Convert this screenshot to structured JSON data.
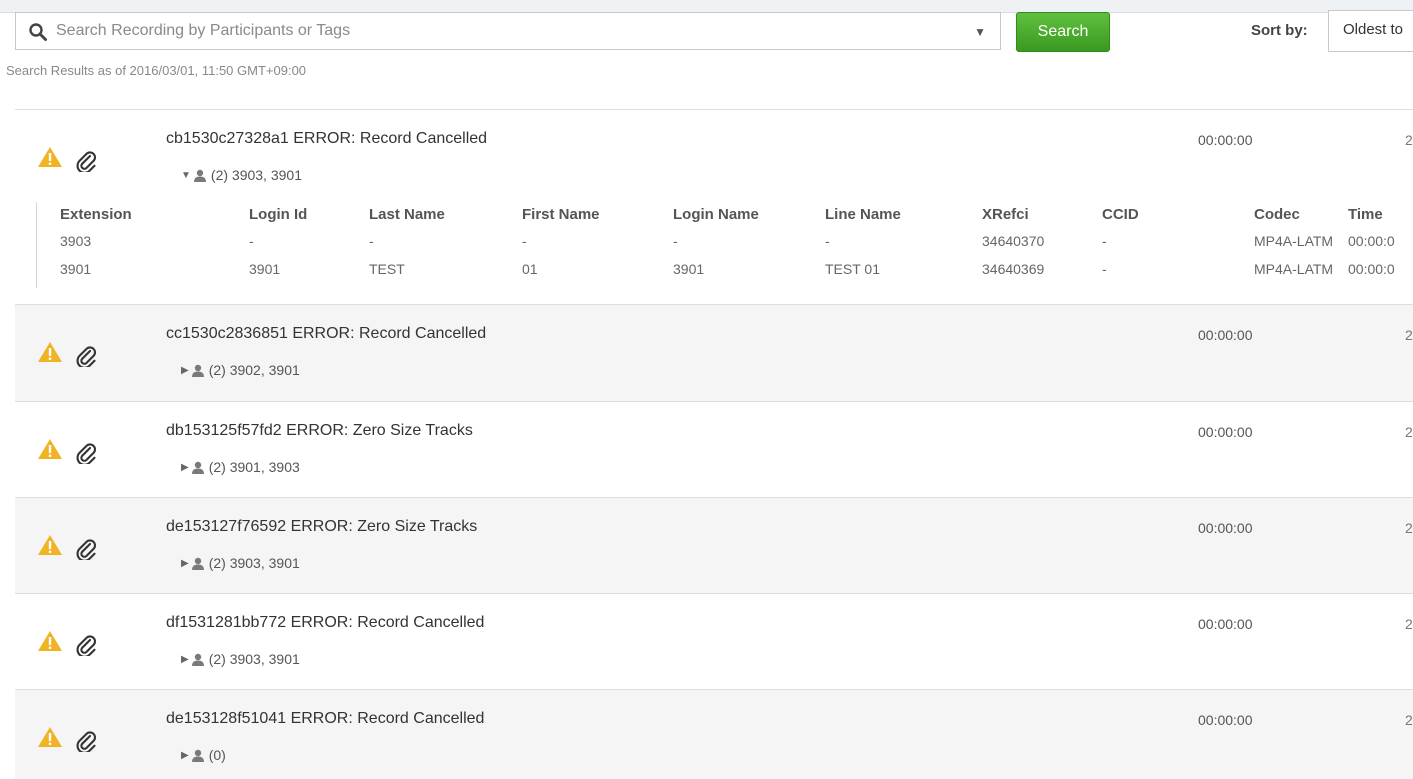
{
  "search": {
    "placeholder": "Search Recording by Participants or Tags",
    "dropdown_glyph": "▼",
    "button_label": "Search",
    "button_color": "#4caf2a"
  },
  "sort": {
    "label": "Sort by:",
    "value": "Oldest to"
  },
  "results_info": "Search Results as of 2016/03/01, 11:50 GMT+09:00",
  "detail_table": {
    "headers": [
      "Extension",
      "Login Id",
      "Last Name",
      "First Name",
      "Login Name",
      "Line Name",
      "XRefci",
      "CCID",
      "Codec",
      "Time"
    ],
    "rows": [
      [
        "3903",
        "-",
        "-",
        "-",
        "-",
        "-",
        "34640370",
        "-",
        "MP4A-LATM",
        "00:00:0"
      ],
      [
        "3901",
        "3901",
        "TEST",
        "01",
        "3901",
        "TEST 01",
        "34640369",
        "-",
        "MP4A-LATM",
        "00:00:0"
      ]
    ]
  },
  "recordings": [
    {
      "title": "cb1530c27328a1 ERROR: Record Cancelled",
      "toggle": "▼",
      "participants": "(2) 3903, 3901",
      "duration": "00:00:00",
      "trunc": "2",
      "expanded": true
    },
    {
      "title": "cc1530c2836851 ERROR: Record Cancelled",
      "toggle": "▶",
      "participants": "(2) 3902, 3901",
      "duration": "00:00:00",
      "trunc": "2",
      "expanded": false
    },
    {
      "title": "db153125f57fd2 ERROR: Zero Size Tracks",
      "toggle": "▶",
      "participants": "(2) 3901, 3903",
      "duration": "00:00:00",
      "trunc": "2",
      "expanded": false
    },
    {
      "title": "de153127f76592 ERROR: Zero Size Tracks",
      "toggle": "▶",
      "participants": "(2) 3903, 3901",
      "duration": "00:00:00",
      "trunc": "2",
      "expanded": false
    },
    {
      "title": "df1531281bb772 ERROR: Record Cancelled",
      "toggle": "▶",
      "participants": "(2) 3903, 3901",
      "duration": "00:00:00",
      "trunc": "2",
      "expanded": false
    },
    {
      "title": "de153128f51041 ERROR: Record Cancelled",
      "toggle": "▶",
      "participants": "(0)",
      "duration": "00:00:00",
      "trunc": "2",
      "expanded": false
    }
  ],
  "colors": {
    "warning": "#f0b323",
    "row_alt_bg": "#f5f5f5"
  },
  "icons": [
    "search-icon",
    "chevron-down-icon",
    "warning-icon",
    "paperclip-icon",
    "person-icon"
  ]
}
